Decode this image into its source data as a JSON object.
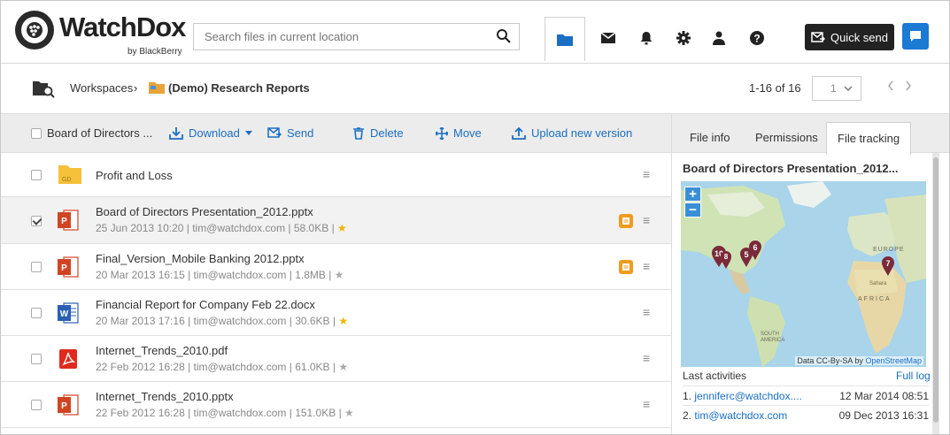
{
  "header": {
    "brand": "WatchDox",
    "brand_sub": "by BlackBerry",
    "search_placeholder": "Search files in current location",
    "quick_send_label": "Quick send",
    "nav_icons": [
      "folder-icon",
      "envelope-icon",
      "bell-icon",
      "gear-icon",
      "user-icon",
      "help-icon"
    ]
  },
  "breadcrumb": {
    "root": "Workspaces",
    "separator": "›",
    "current": "(Demo) Research Reports",
    "pager_text": "1-16 of 16",
    "page_value": "1"
  },
  "toolbar": {
    "selection_label": "Board of Directors ...",
    "download_label": "Download",
    "send_label": "Send",
    "delete_label": "Delete",
    "move_label": "Move",
    "upload_label": "Upload new version"
  },
  "files": [
    {
      "name": "Profit and Loss",
      "meta": "",
      "type": "folder",
      "checked": false,
      "note": false,
      "starred": null
    },
    {
      "name": "Board of Directors Presentation_2012.pptx",
      "meta": "25 Jun 2013 10:20 | tim@watchdox.com | 58.0KB |",
      "type": "pptx",
      "checked": true,
      "note": true,
      "starred": true
    },
    {
      "name": "Final_Version_Mobile Banking 2012.pptx",
      "meta": "20 Mar 2013 16:15 | tim@watchdox.com | 1.8MB |",
      "type": "pptx",
      "checked": false,
      "note": true,
      "starred": false
    },
    {
      "name": "Financial Report for Company Feb 22.docx",
      "meta": "20 Mar 2013 17:16 | tim@watchdox.com | 30.6KB |",
      "type": "docx",
      "checked": false,
      "note": false,
      "starred": true
    },
    {
      "name": "Internet_Trends_2010.pdf",
      "meta": "22 Feb 2012 16:28 | tim@watchdox.com | 61.0KB |",
      "type": "pdf",
      "checked": false,
      "note": false,
      "starred": false
    },
    {
      "name": "Internet_Trends_2010.pptx",
      "meta": "22 Feb 2012 16:28 | tim@watchdox.com | 151.0KB |",
      "type": "pptx",
      "checked": false,
      "note": false,
      "starred": false
    }
  ],
  "folder_badge": "GD",
  "panel": {
    "tabs": [
      "File info",
      "Permissions",
      "File tracking"
    ],
    "active_tab": "File tracking",
    "title": "Board of Directors Presentation_2012...",
    "map_attribution": "Data CC-By-SA by",
    "map_attribution_link": "OpenStreetMap",
    "map_labels": {
      "europe": "EUROPE",
      "africa": "AFRICA",
      "south_america": "SOUTH AMERICA",
      "sahara": "Sahara"
    },
    "pins": [
      "10",
      "8",
      "5",
      "6",
      "7"
    ],
    "last_activities_label": "Last activities",
    "full_log_label": "Full log",
    "activities": [
      {
        "index": "1.",
        "user": "jenniferc@watchdox....",
        "time": "12 Mar 2014 08:51"
      },
      {
        "index": "2.",
        "user": "tim@watchdox.com",
        "time": "09 Dec 2013 16:31"
      }
    ]
  },
  "colors": {
    "accent": "#1a7ad4",
    "note": "#f29b1d",
    "pin": "#7a2a3a",
    "star": "#f0b400"
  }
}
